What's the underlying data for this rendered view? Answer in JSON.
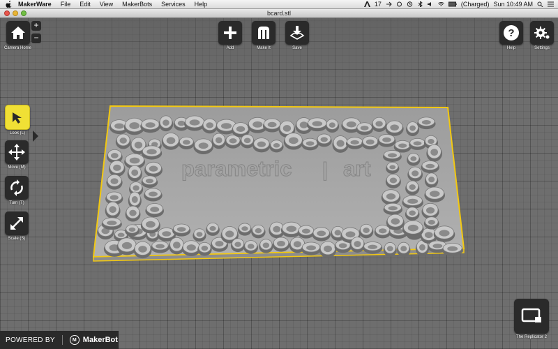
{
  "menubar": {
    "app_name": "MakerWare",
    "items": [
      "File",
      "Edit",
      "View",
      "MakerBots",
      "Services",
      "Help"
    ],
    "status": {
      "notify_count": "17",
      "battery": "(Charged)",
      "clock": "Sun 10:49 AM"
    }
  },
  "window": {
    "title": "bcard.stl"
  },
  "toolbar": {
    "camera_home": "Camera Home",
    "add": "Add",
    "make_it": "Make It",
    "save": "Save",
    "help": "Help",
    "settings": "Settings"
  },
  "left_tools": {
    "look": "Look (L)",
    "move": "Move (M)",
    "turn": "Turn (T)",
    "scale": "Scale (S)"
  },
  "model": {
    "text_left": "parametric",
    "text_sep": "|",
    "text_right": "art"
  },
  "footer": {
    "powered_by": "POWERED BY",
    "brand": "MakerBot",
    "logo_letter": "M"
  },
  "printer": {
    "name": "The Replicator 2"
  },
  "colors": {
    "accent_yellow": "#f0e035",
    "outline_yellow": "#f2c811",
    "button_dark": "#2a2a2a",
    "model_gray": "#a9a9a9"
  }
}
